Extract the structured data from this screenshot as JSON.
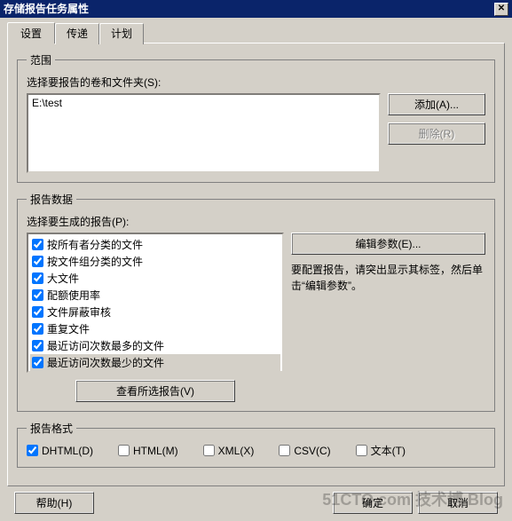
{
  "window": {
    "title": "存储报告任务属性"
  },
  "tabs": [
    {
      "label": "设置",
      "active": true
    },
    {
      "label": "传递",
      "active": false
    },
    {
      "label": "计划",
      "active": false
    }
  ],
  "scope": {
    "legend": "范围",
    "instruction": "选择要报告的卷和文件夹(S):",
    "paths": [
      "E:\\test"
    ],
    "add_label": "添加(A)...",
    "remove_label": "删除(R)"
  },
  "report_data": {
    "legend": "报告数据",
    "instruction": "选择要生成的报告(P):",
    "reports": [
      {
        "label": "按所有者分类的文件",
        "checked": true
      },
      {
        "label": "按文件组分类的文件",
        "checked": true
      },
      {
        "label": "大文件",
        "checked": true
      },
      {
        "label": "配额使用率",
        "checked": true
      },
      {
        "label": "文件屏蔽审核",
        "checked": true
      },
      {
        "label": "重复文件",
        "checked": true
      },
      {
        "label": "最近访问次数最多的文件",
        "checked": true
      },
      {
        "label": "最近访问次数最少的文件",
        "checked": true,
        "selected": true
      }
    ],
    "view_selected_label": "查看所选报告(V)",
    "edit_params_label": "编辑参数(E)...",
    "hint": "要配置报告，请突出显示其标签，然后单击“编辑参数”。"
  },
  "formats": {
    "legend": "报告格式",
    "options": [
      {
        "label": "DHTML(D)",
        "checked": true
      },
      {
        "label": "HTML(M)",
        "checked": false
      },
      {
        "label": "XML(X)",
        "checked": false
      },
      {
        "label": "CSV(C)",
        "checked": false
      },
      {
        "label": "文本(T)",
        "checked": false
      }
    ]
  },
  "buttons": {
    "help": "帮助(H)",
    "ok": "确定",
    "cancel": "取消"
  },
  "watermark": "51CTO.com 技术博 Blog"
}
